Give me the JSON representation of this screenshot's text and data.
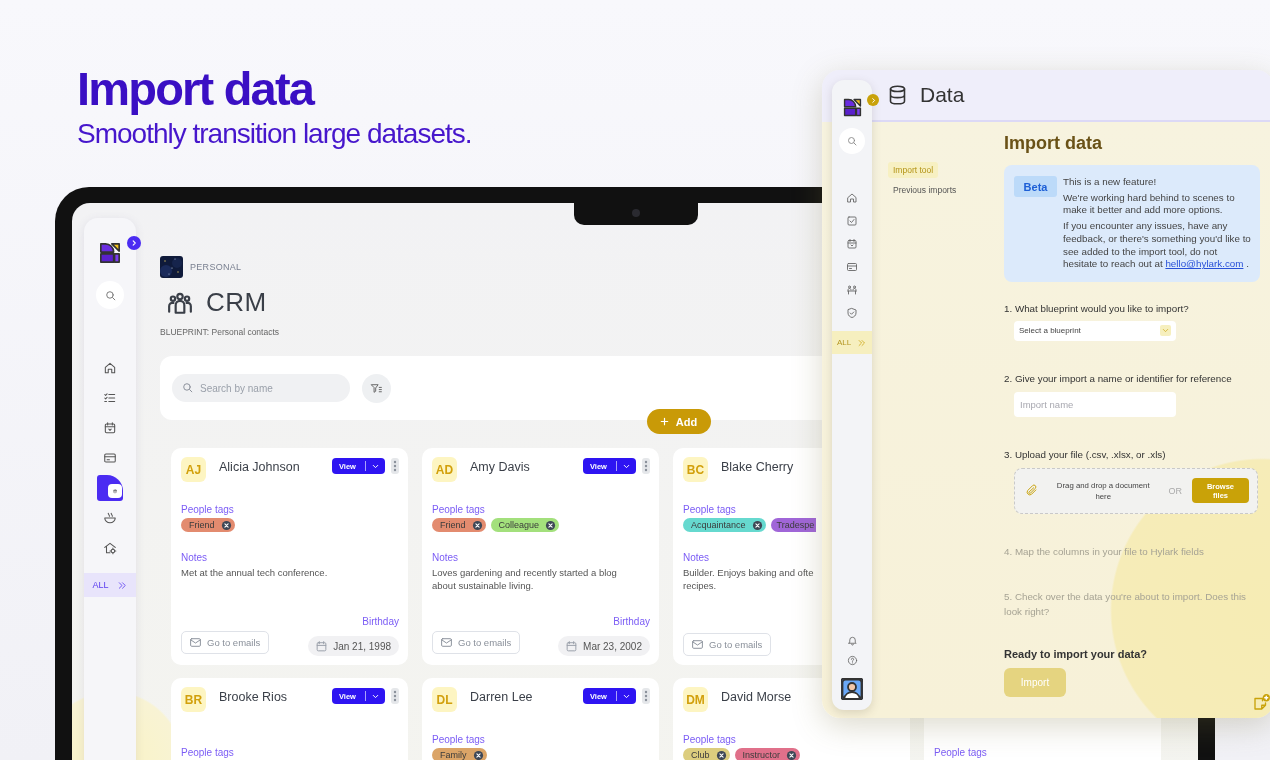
{
  "hero": {
    "title": "Import data",
    "subtitle": "Smoothly transition large datasets."
  },
  "crm_app": {
    "sidebar": {
      "items": [
        {
          "selected": false
        },
        {
          "selected": false
        },
        {
          "selected": false
        },
        {
          "selected": false
        },
        {
          "selected": true
        },
        {
          "selected": false
        },
        {
          "selected": false
        }
      ],
      "all_label": "ALL"
    },
    "space": "PERSONAL",
    "title": "CRM",
    "blueprint": "BLUEPRINT: Personal contacts",
    "search": {
      "placeholder": "Search by name"
    },
    "add_button": "Add",
    "card_rows": [
      {
        "cards": [
          {
            "initials": "AJ",
            "name": "Alicia Johnson",
            "view": "View",
            "tags_label": "People tags",
            "tags": [
              {
                "label": "Friend",
                "color": "#e38b6f",
                "removable": true
              }
            ],
            "notes_label": "Notes",
            "notes": [
              "Met at the annual tech conference."
            ],
            "birthday_label": "Birthday",
            "email_button": "Go to emails",
            "birthday": "Jan 21, 1998"
          },
          {
            "initials": "AD",
            "name": "Amy Davis",
            "view": "View",
            "tags_label": "People tags",
            "tags": [
              {
                "label": "Friend",
                "color": "#e38b6f",
                "removable": true
              },
              {
                "label": "Colleague",
                "color": "#a3e07c",
                "removable": true
              }
            ],
            "notes_label": "Notes",
            "notes": [
              "Loves gardening and recently started a blog",
              "about sustainable living."
            ],
            "birthday_label": "Birthday",
            "email_button": "Go to emails",
            "birthday": "Mar 23, 2002"
          },
          {
            "initials": "BC",
            "name": "Blake Cherry",
            "tags_label": "People tags",
            "tags": [
              {
                "label": "Acquaintance",
                "color": "#66d9cf",
                "removable": true
              },
              {
                "label": "Tradespe",
                "color": "#a066d8",
                "removable": false
              }
            ],
            "notes_label": "Notes",
            "notes": [
              "Builder. Enjoys baking and ofte",
              "recipes."
            ],
            "email_button": "Go to emails"
          }
        ]
      },
      {
        "cards": [
          {
            "initials": "BR",
            "name": "Brooke Rios",
            "view": "View",
            "tags_label": "People tags"
          },
          {
            "initials": "DL",
            "name": "Darren Lee",
            "view": "View",
            "tags_label": "People tags",
            "tags": [
              {
                "label": "Family",
                "color": "#dba467",
                "removable": true
              }
            ]
          },
          {
            "initials": "DM",
            "name": "David Morse",
            "tags_label": "People tags",
            "tags": [
              {
                "label": "Club",
                "color": "#dccd7e",
                "removable": true
              },
              {
                "label": "Instructor",
                "color": "#e0708a",
                "removable": true
              }
            ]
          },
          {
            "tags_label": "People tags"
          }
        ]
      }
    ]
  },
  "import_panel": {
    "title": "Data",
    "sidebar": {
      "items": [
        {
          "selected": false
        },
        {
          "selected": false
        },
        {
          "selected": false
        },
        {
          "selected": false
        },
        {
          "selected": false
        },
        {
          "selected": false
        }
      ],
      "all_label": "ALL"
    },
    "subnav": [
      {
        "label": "Import tool",
        "selected": true
      },
      {
        "label": "Previous imports",
        "selected": false
      }
    ],
    "heading": "Import data",
    "notice": {
      "badge": "Beta",
      "title": "This is a new feature!",
      "paragraphs": [
        "We're working hard behind to scenes to make it better and add more options.",
        "If you encounter any issues, have any feedback, or there's something you'd like to see added to the import tool, do not hesitate to reach out at"
      ],
      "link": "hello@hylark.com",
      "trail": "."
    },
    "steps": [
      {
        "kind": "select",
        "label": "1. What blueprint would you like to import?",
        "placeholder": "Select a blueprint",
        "disabled": false
      },
      {
        "kind": "input",
        "label": "2. Give your import a name or identifier for reference",
        "placeholder": "Import name",
        "disabled": false
      },
      {
        "kind": "upload",
        "label": "3. Upload your file (.csv, .xlsx, or .xls)",
        "drop_text": "Drag and drop a document here",
        "or": "OR",
        "browse": "Browse files",
        "disabled": false
      },
      {
        "kind": "text",
        "label": "4. Map the columns in your file to Hylark fields",
        "disabled": true
      },
      {
        "kind": "text",
        "label": "5. Check over the data you're about to import. Does this look right?",
        "disabled": true
      }
    ],
    "ready": "Ready to import your data?",
    "import_button": {
      "label": "Import",
      "disabled": true
    }
  }
}
